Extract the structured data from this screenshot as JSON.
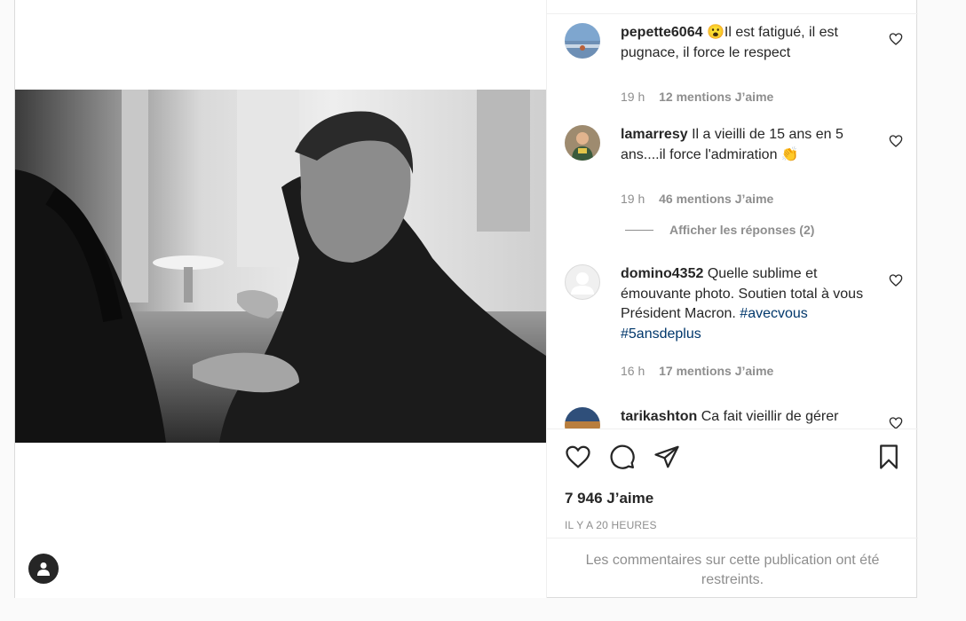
{
  "comments": [
    {
      "username": "pepette6064",
      "emoji": "😮",
      "text": "Il est fatigué, il est pugnace, il force le respect",
      "time": "19 h",
      "likes": "12 mentions J’aime"
    },
    {
      "username": "lamarresy",
      "text": "Il a vieilli de 15 ans en 5 ans....il force l'admiration",
      "emoji": "👏",
      "time": "19 h",
      "likes": "46 mentions J’aime",
      "view_replies": "Afficher les réponses (2)"
    },
    {
      "username": "domino4352",
      "text": "Quelle sublime et émouvante photo. Soutien total à vous Président Macron.",
      "hashtags": [
        "#avecvous",
        "#5ansdeplus"
      ],
      "time": "16 h",
      "likes": "17 mentions J’aime"
    },
    {
      "username": "tarikashton",
      "text": "Ca fait vieillir de gérer"
    }
  ],
  "post": {
    "likes_count": "7 946 J’aime",
    "timestamp": "IL Y A 20 HEURES",
    "restricted_notice": "Les commentaires sur cette publication ont été restreints."
  },
  "icons": {
    "like": "heart-icon",
    "comment": "comment-icon",
    "share": "paper-plane-icon",
    "save": "bookmark-icon",
    "tagged_user": "user-silhouette-icon"
  }
}
